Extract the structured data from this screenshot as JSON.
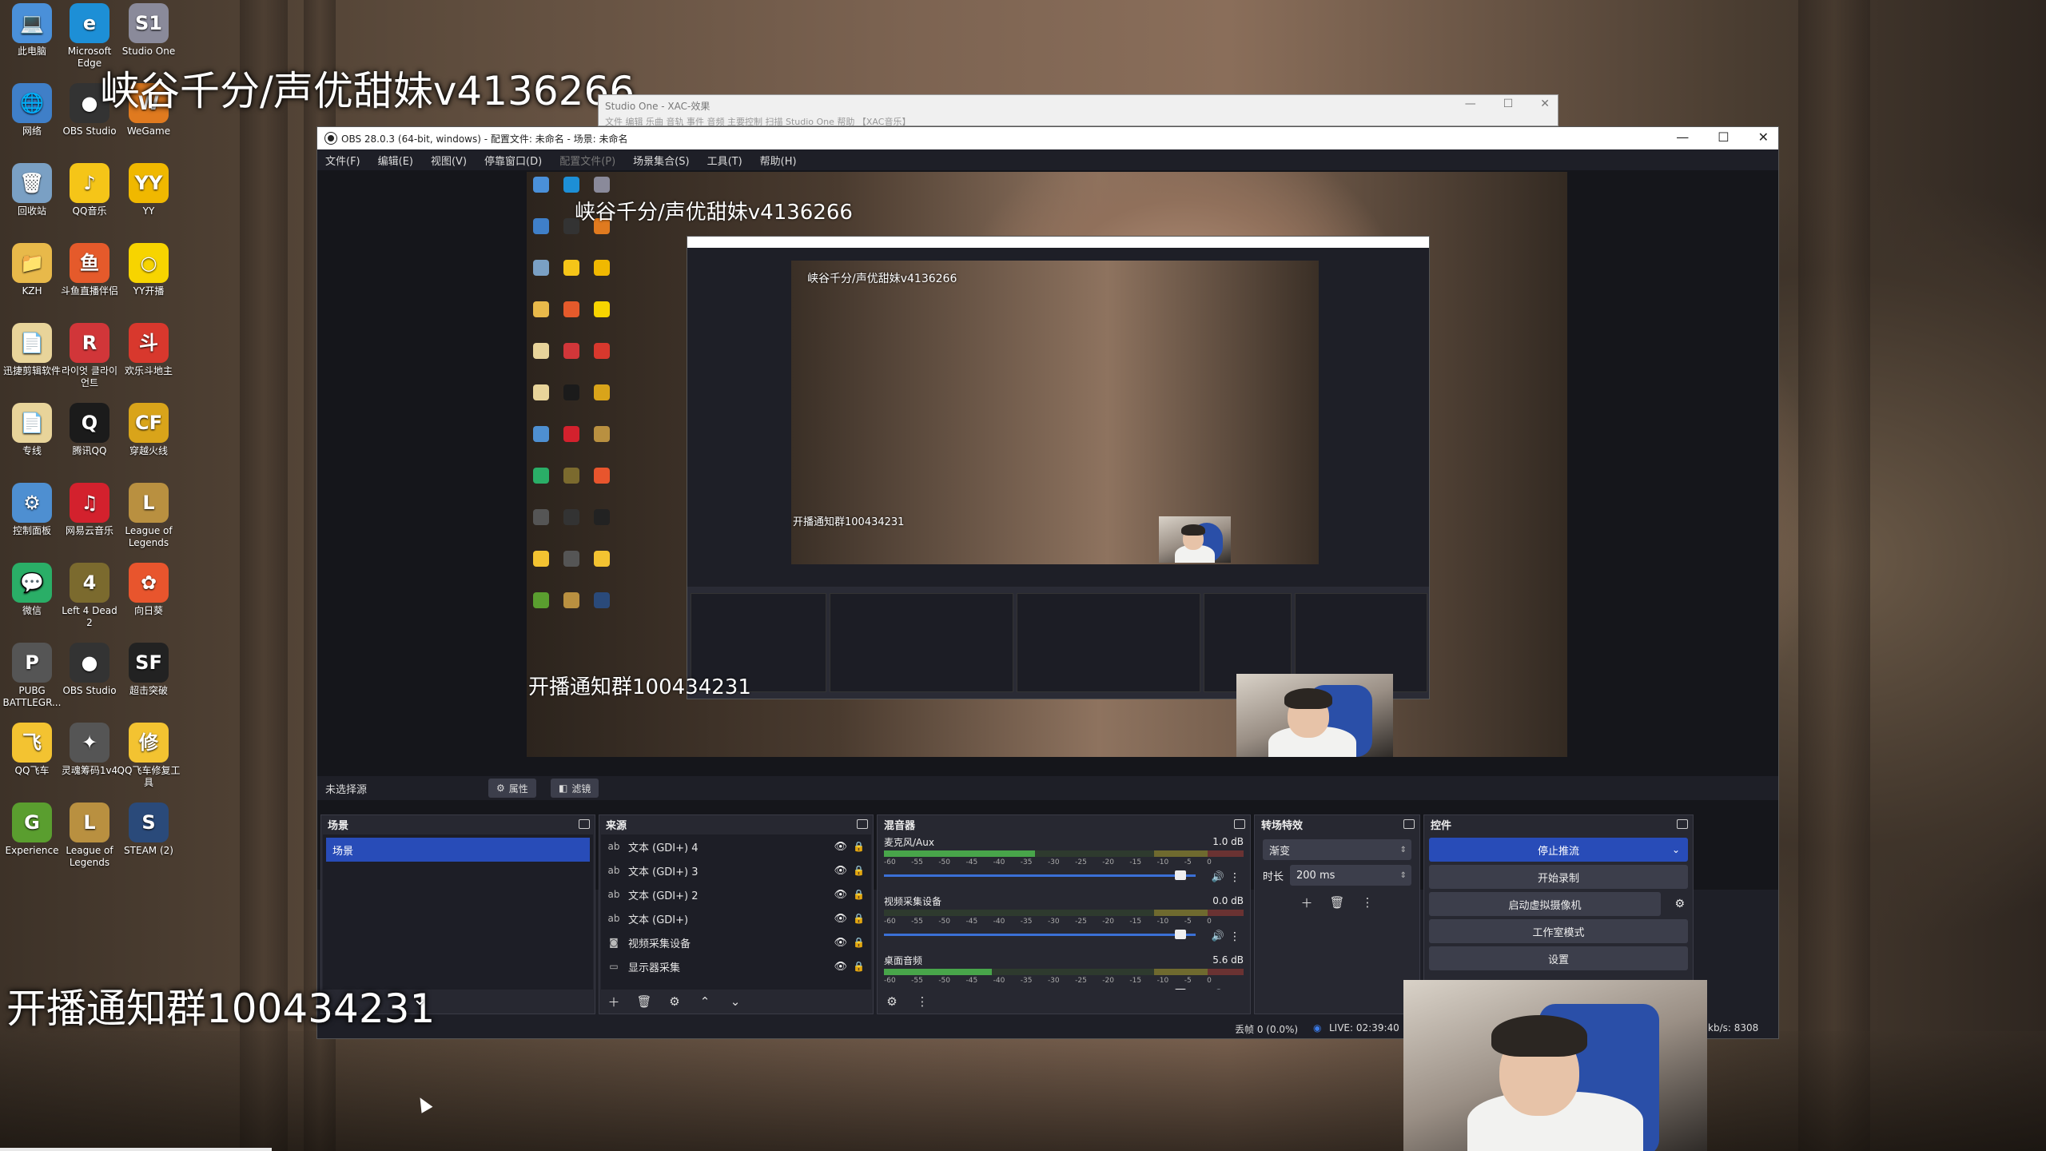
{
  "desktop": {
    "icons": [
      {
        "label": "此电脑",
        "glyph": "💻",
        "color": "#4a90d9"
      },
      {
        "label": "Microsoft Edge",
        "glyph": "e",
        "color": "#1d8fd6"
      },
      {
        "label": "Studio One",
        "glyph": "S1",
        "color": "#8a8a9a"
      },
      {
        "label": "网络",
        "glyph": "🌐",
        "color": "#3f7fc8"
      },
      {
        "label": "OBS Studio",
        "glyph": "●",
        "color": "#333"
      },
      {
        "label": "WeGame",
        "glyph": "W",
        "color": "#e07a1f"
      },
      {
        "label": "回收站",
        "glyph": "🗑",
        "color": "#7aa0c4"
      },
      {
        "label": "QQ音乐",
        "glyph": "♪",
        "color": "#f5c518"
      },
      {
        "label": "YY",
        "glyph": "YY",
        "color": "#f0b800"
      },
      {
        "label": "KZH",
        "glyph": "📁",
        "color": "#e8b94a"
      },
      {
        "label": "斗鱼直播伴侣",
        "glyph": "鱼",
        "color": "#e55a2b"
      },
      {
        "label": "YY开播",
        "glyph": "○",
        "color": "#f7d400"
      },
      {
        "label": "迅捷剪辑软件",
        "glyph": "📄",
        "color": "#e8d49a"
      },
      {
        "label": "라이엇 클라이언트",
        "glyph": "R",
        "color": "#d13639"
      },
      {
        "label": "欢乐斗地主",
        "glyph": "斗",
        "color": "#d8382d"
      },
      {
        "label": "专线",
        "glyph": "📄",
        "color": "#e8d49a"
      },
      {
        "label": "腾讯QQ",
        "glyph": "Q",
        "color": "#1b1b1b"
      },
      {
        "label": "穿越火线",
        "glyph": "CF",
        "color": "#d9a41a"
      },
      {
        "label": "控制面板",
        "glyph": "⚙",
        "color": "#4e8fd1"
      },
      {
        "label": "网易云音乐",
        "glyph": "♫",
        "color": "#d3212d"
      },
      {
        "label": "League of Legends",
        "glyph": "L",
        "color": "#b99040"
      },
      {
        "label": "微信",
        "glyph": "💬",
        "color": "#2aae67"
      },
      {
        "label": "Left 4 Dead 2",
        "glyph": "4",
        "color": "#7b6a2e"
      },
      {
        "label": "向日葵",
        "glyph": "✿",
        "color": "#e8552d"
      },
      {
        "label": "PUBG BATTLEGR...",
        "glyph": "P",
        "color": "#555"
      },
      {
        "label": "OBS Studio",
        "glyph": "●",
        "color": "#333"
      },
      {
        "label": "超击突破",
        "glyph": "SF",
        "color": "#222"
      },
      {
        "label": "QQ飞车",
        "glyph": "飞",
        "color": "#f3c331"
      },
      {
        "label": "灵魂筹码1v4",
        "glyph": "✦",
        "color": "#555"
      },
      {
        "label": "QQ飞车修复工具",
        "glyph": "修",
        "color": "#f3c331"
      },
      {
        "label": "Experience",
        "glyph": "G",
        "color": "#5a9e2f"
      },
      {
        "label": "League of Legends",
        "glyph": "L",
        "color": "#b99040"
      },
      {
        "label": "STEAM (2)",
        "glyph": "S",
        "color": "#2a4a7a"
      }
    ],
    "overlay_top": "峡谷千分/声优甜妹v4136266",
    "overlay_bottom": "开播通知群100434231"
  },
  "studio_one": {
    "title": "Studio One - XAC-效果",
    "menu": "文件  编辑  乐曲  音轨  事件  音频  主要控制  扫描  Studio One  帮助  【XAC音乐】"
  },
  "obs": {
    "title": "OBS 28.0.3 (64-bit, windows) - 配置文件: 未命名 - 场景: 未命名",
    "menu": [
      "文件(F)",
      "编辑(E)",
      "视图(V)",
      "停靠窗口(D)",
      "配置文件(P)",
      "场景集合(S)",
      "工具(T)",
      "帮助(H)"
    ],
    "preview": {
      "overlay_top": "峡谷千分/声优甜妹v4136266",
      "overlay_bottom": "开播通知群100434231",
      "overlay_mini": "峡谷千分/声优甜妹v4136266",
      "overlay_mini_bottom": "开播通知群100434231"
    },
    "context": {
      "no_source": "未选择源",
      "properties": "属性",
      "filters": "滤镜"
    },
    "scenes": {
      "title": "场景",
      "items": [
        "场景"
      ]
    },
    "sources": {
      "title": "来源",
      "items": [
        {
          "name": "文本 (GDI+) 4",
          "icon": "ab"
        },
        {
          "name": "文本 (GDI+) 3",
          "icon": "ab"
        },
        {
          "name": "文本 (GDI+) 2",
          "icon": "ab"
        },
        {
          "name": "文本 (GDI+)",
          "icon": "ab"
        },
        {
          "name": "视频采集设备",
          "icon": "cam"
        },
        {
          "name": "显示器采集",
          "icon": "monitor"
        }
      ]
    },
    "mixer": {
      "title": "混音器",
      "ticks": [
        "-60",
        "-55",
        "-50",
        "-45",
        "-40",
        "-35",
        "-30",
        "-25",
        "-20",
        "-15",
        "-10",
        "-5",
        "0"
      ],
      "channels": [
        {
          "name": "麦克风/Aux",
          "db": "1.0 dB",
          "level": 0.42,
          "volume": 0.97
        },
        {
          "name": "视频采集设备",
          "db": "0.0 dB",
          "level": 0.0,
          "volume": 0.97
        },
        {
          "name": "桌面音频",
          "db": "5.6 dB",
          "level": 0.3,
          "volume": 0.97
        }
      ]
    },
    "transitions": {
      "title": "转场特效",
      "selected": "渐变",
      "duration_label": "时长",
      "duration_value": "200 ms"
    },
    "controls": {
      "title": "控件",
      "stop_stream": "停止推流",
      "start_record": "开始录制",
      "virtual_cam": "启动虚拟摄像机",
      "studio_mode": "工作室模式",
      "settings": "设置"
    },
    "status": {
      "dropped": "丢帧 0 (0.0%)",
      "live": "LIVE: 02:39:40",
      "kbps": "kb/s: 8308"
    }
  },
  "colors": {
    "accent": "#284cb8",
    "obs_bg": "#1e1f27",
    "dock_bg": "#272831"
  }
}
